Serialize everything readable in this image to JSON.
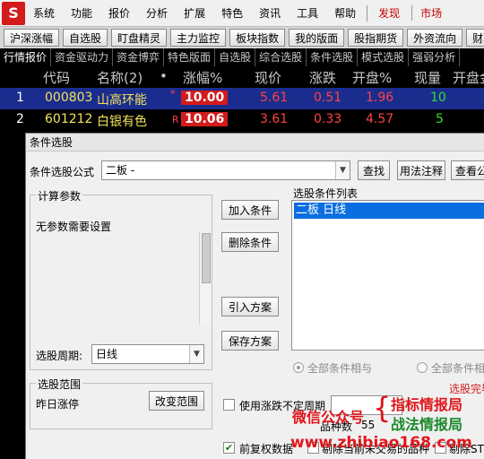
{
  "menubar": {
    "logo": "S",
    "items": [
      "系统",
      "功能",
      "报价",
      "分析",
      "扩展",
      "特色",
      "资讯",
      "工具",
      "帮助"
    ],
    "right_items": [
      "发现",
      "市场"
    ]
  },
  "toolbar": [
    "沪深涨幅",
    "自选股",
    "盯盘精灵",
    "主力监控",
    "板块指数",
    "我的版面",
    "股指期货",
    "外资流向",
    "财联"
  ],
  "tabs": [
    "行情报价",
    "资金驱动力",
    "资金博弈",
    "特色版面",
    "自选股",
    "综合选股",
    "条件选股",
    "模式选股",
    "强弱分析"
  ],
  "quote": {
    "headers": {
      "code": "代码",
      "name": "名称(2)",
      "dot": "•",
      "pct": "涨幅%",
      "price": "现价",
      "chg": "涨跌",
      "open_pct": "开盘%",
      "vol": "现量",
      "open_amt": "开盘金"
    },
    "rows": [
      {
        "idx": "1",
        "code": "000803",
        "name": "山高环能",
        "mark": "*",
        "pct": "10.00",
        "price": "5.61",
        "chg": "0.51",
        "open_pct": "1.96",
        "vol": "10"
      },
      {
        "idx": "2",
        "code": "601212",
        "name": "白银有色",
        "mark": "R",
        "pct": "10.06",
        "price": "3.61",
        "chg": "0.33",
        "open_pct": "4.57",
        "vol": "5"
      }
    ]
  },
  "dialog": {
    "title": "条件选股",
    "formula_label": "条件选股公式",
    "formula_value": "二板  -",
    "find_button": "查找",
    "usage_button": "用法注释",
    "view_button": "查看公",
    "params_group": "计算参数",
    "params_text": "无参数需要设置",
    "add_button": "加入条件",
    "delete_button": "删除条件",
    "import_button": "引入方案",
    "save_button": "保存方案",
    "list_label": "选股条件列表",
    "list_items": [
      "二板  日线"
    ],
    "period_label": "选股周期:",
    "period_value": "日线",
    "radio_all_and": "全部条件相与",
    "radio_all_or": "全部条件相或",
    "range_group": "选股范围",
    "range_text": "昨日涨停",
    "change_range_button": "改变范围",
    "use_limit_check": "使用涨跌不定周期",
    "stock_count_label": "品种数",
    "stock_count": "55",
    "forward_adjust_check": "前复权数据",
    "delisting_text": "剔除当前未交易的品种",
    "st_text": "剔除ST品种",
    "select_result": "选股完毕"
  },
  "watermark": {
    "wechat": "微信公众号",
    "line1": "指标情报局",
    "line2": "战法情报局",
    "url": "www.zhibiao168.com"
  },
  "colors": {
    "accent_red": "#d31b1b",
    "selection_blue": "#1a2d8f",
    "list_select": "#0a6ee0",
    "up_red": "#ff4141",
    "volume_green": "#2ee02e"
  }
}
